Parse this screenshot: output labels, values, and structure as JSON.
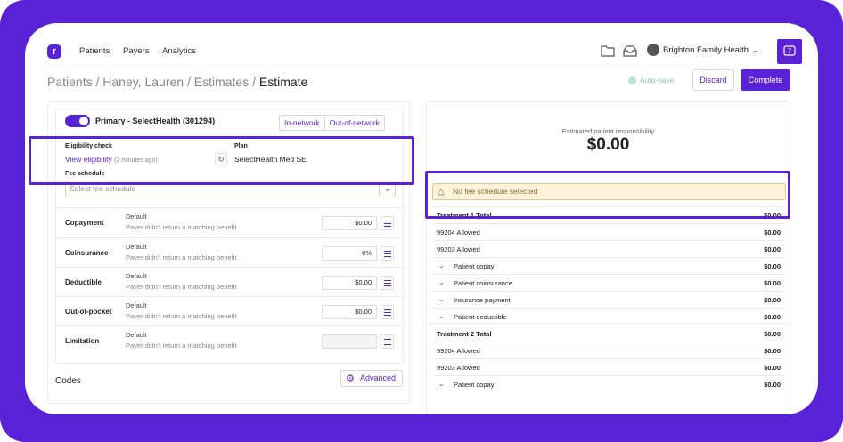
{
  "nav": {
    "logo": "r",
    "links": [
      "Patients",
      "Payers",
      "Analytics"
    ],
    "org_name": "Brighton Family Health"
  },
  "header": {
    "breadcrumb_prefix": "Patients / Haney, Lauren / Estimates / ",
    "breadcrumb_current": "Estimate",
    "autosave": "Auto-save",
    "discard": "Discard",
    "complete": "Complete"
  },
  "coverage": {
    "primary_label": "Primary - SelectHealth (301294)",
    "network_options": [
      "In-network",
      "Out-of-network"
    ],
    "eligibility_label": "Eligibility check",
    "eligibility_link": "View eligibility",
    "eligibility_time": "(2 minutes ago)",
    "plan_label": "Plan",
    "plan_value": "SelectHealth Med SE",
    "fee_label": "Fee schedule",
    "fee_placeholder": "Select fee schedule",
    "benefits": [
      {
        "name": "Copayment",
        "type": "Default",
        "note": "Payer didn't return a matching benefit",
        "value": "$0.00"
      },
      {
        "name": "Coinsurance",
        "type": "Default",
        "note": "Payer didn't return a matching benefit",
        "value": "0%"
      },
      {
        "name": "Deductible",
        "type": "Default",
        "note": "Payer didn't return a matching benefit",
        "value": "$0.00"
      },
      {
        "name": "Out-of-pocket",
        "type": "Default",
        "note": "Payer didn't return a matching benefit",
        "value": "$0.00"
      },
      {
        "name": "Limitation",
        "type": "Default",
        "note": "Payer didn't return a matching benefit",
        "value": ""
      }
    ],
    "codes_label": "Codes",
    "advanced_label": "Advanced"
  },
  "summary": {
    "est_label": "Estimated patient responsibility",
    "est_value": "$0.00",
    "warning": "No fee schedule selected",
    "rows": [
      {
        "label": "Treatment 1 Total",
        "value": "$0.00",
        "kind": "total"
      },
      {
        "label": "99204 Allowed",
        "value": "$0.00",
        "kind": "line"
      },
      {
        "label": "99203 Allowed",
        "value": "$0.00",
        "kind": "line"
      },
      {
        "label": "Patient copay",
        "value": "$0.00",
        "kind": "sub"
      },
      {
        "label": "Patient coinsurance",
        "value": "$0.00",
        "kind": "sub"
      },
      {
        "label": "Insurance payment",
        "value": "$0.00",
        "kind": "sub"
      },
      {
        "label": "Patient deductible",
        "value": "$0.00",
        "kind": "sub"
      },
      {
        "label": "Treatment 2 Total",
        "value": "$0.00",
        "kind": "total"
      },
      {
        "label": "99204 Allowed",
        "value": "$0.00",
        "kind": "line"
      },
      {
        "label": "99203 Allowed",
        "value": "$0.00",
        "kind": "line"
      },
      {
        "label": "Patient copay",
        "value": "$0.00",
        "kind": "sub"
      }
    ]
  },
  "colors": {
    "accent": "#5a22d6",
    "warning_bg": "#fdf3dd"
  }
}
